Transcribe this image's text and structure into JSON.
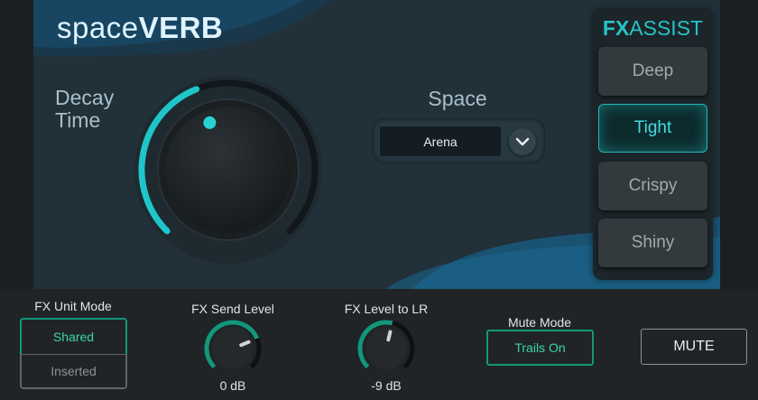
{
  "brand": {
    "light": "space",
    "bold": "VERB"
  },
  "decay": {
    "label_line1": "Decay",
    "label_line2": "Time",
    "level": 0.42
  },
  "space": {
    "title": "Space",
    "value": "Arena"
  },
  "fx_assist": {
    "title_bold": "FX",
    "title_light": "ASSIST",
    "presets": [
      {
        "label": "Deep",
        "active": false
      },
      {
        "label": "Tight",
        "active": true
      },
      {
        "label": "Crispy",
        "active": false
      },
      {
        "label": "Shiny",
        "active": false
      }
    ]
  },
  "bottom": {
    "fx_unit_mode": {
      "label": "FX Unit Mode",
      "options": [
        "Shared",
        "Inserted"
      ],
      "selected": "Shared"
    },
    "fx_send_level": {
      "label": "FX Send Level",
      "value": "0 dB",
      "level": 0.75
    },
    "fx_level_lr": {
      "label": "FX Level to LR",
      "value": "-9 dB",
      "level": 0.55
    },
    "mute_mode": {
      "label": "Mute Mode",
      "value": "Trails On"
    },
    "mute_label": "MUTE"
  },
  "colors": {
    "accent": "#1fc6c9",
    "green_accent": "#12977a",
    "panel_bg": "#213039",
    "bottom_bg": "#202426"
  },
  "icons": {
    "space_dropdown": "chevron-down-icon"
  }
}
